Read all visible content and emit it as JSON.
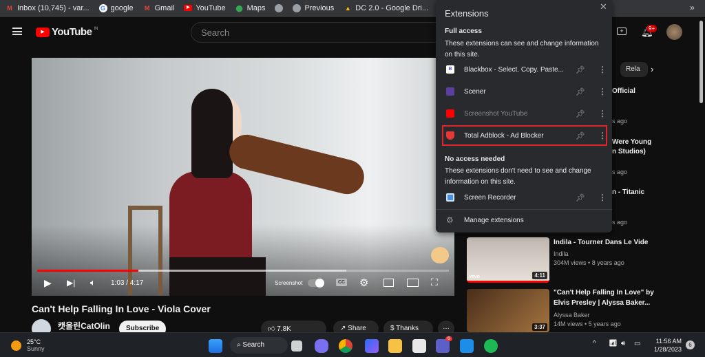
{
  "bookmarks": [
    {
      "label": "Inbox (10,745) - var...",
      "icon": "gmail-icon",
      "color": "#ea4335"
    },
    {
      "label": "google",
      "icon": "google-icon",
      "color": "#4285f4"
    },
    {
      "label": "Gmail",
      "icon": "gmail-icon",
      "color": "#ea4335"
    },
    {
      "label": "YouTube",
      "icon": "youtube-icon",
      "color": "#ff0000"
    },
    {
      "label": "Maps",
      "icon": "maps-icon",
      "color": "#34a853"
    },
    {
      "label": "",
      "icon": "globe-icon",
      "color": "#9aa0a6"
    },
    {
      "label": "Previous",
      "icon": "globe-icon",
      "color": "#9aa0a6"
    },
    {
      "label": "DC 2.0 - Google Dri...",
      "icon": "drive-icon",
      "color": "#fbbc04"
    },
    {
      "label": "",
      "icon": "youtube-icon",
      "color": "#ff0000"
    }
  ],
  "bookmarks_overflow": "»",
  "youtube": {
    "logo": "YouTube",
    "region": "IN",
    "search_placeholder": "Search",
    "notifications": "9+"
  },
  "player": {
    "time": "1:03 / 4:17",
    "progress_percent": 24.6,
    "buffered_percent": 75,
    "screenshot_label": "Screenshot",
    "cc": "CC"
  },
  "video": {
    "title": "Can't Help Falling In Love - Viola Cover",
    "channel": "캣올린CatOlin",
    "subscribe": "Subscribe",
    "likes": "7.8K",
    "share": "Share",
    "thanks": "Thanks"
  },
  "chips": {
    "partial": "Rela"
  },
  "related": [
    {
      "title_partial": "Official",
      "meta_partial": "s ago"
    },
    {
      "title_partial": "Were Young",
      "title_partial2": "n Studios)",
      "meta_partial": "s ago"
    },
    {
      "title_partial": "n - Titanic",
      "meta_partial": "s ago"
    },
    {
      "title": "Indila - Tourner Dans Le Vide",
      "channel": "Indila",
      "views": "304M views",
      "age": "8 years ago",
      "duration": "4:11",
      "badge": "vevo"
    },
    {
      "title": "\"Can't Help Falling In Love\" by",
      "title2": "Elvis Presley | Alyssa Baker...",
      "channel": "Alyssa Baker",
      "views": "14M views",
      "age": "5 years ago",
      "duration": "3:37"
    }
  ],
  "extensions": {
    "title": "Extensions",
    "full_access_heading": "Full access",
    "full_access_desc": "These extensions can see and change information on this site.",
    "full": [
      {
        "name": "Blackbox - Select. Copy. Paste...",
        "icon": "blackbox-icon",
        "color": "#ffffff"
      },
      {
        "name": "Scener",
        "icon": "scener-icon",
        "color": "#5b3fa0"
      },
      {
        "name": "Screenshot YouTube",
        "icon": "screenshot-icon",
        "color": "#ff0000",
        "dimmed": true
      },
      {
        "name": "Total Adblock - Ad Blocker",
        "icon": "shield-icon",
        "color": "#e53935",
        "highlighted": true
      }
    ],
    "no_access_heading": "No access needed",
    "no_access_desc": "These extensions don't need to see and change information on this site.",
    "none": [
      {
        "name": "Screen Recorder",
        "icon": "screen-recorder-icon",
        "color": "#4a90e2"
      }
    ],
    "manage": "Manage extensions",
    "highlight_color": "#e0262b"
  },
  "taskbar": {
    "temp": "25°C",
    "weather": "Sunny",
    "search": "Search",
    "time": "11:56 AM",
    "date": "1/28/2023",
    "teams_badge": "6",
    "notif_count": "6"
  }
}
